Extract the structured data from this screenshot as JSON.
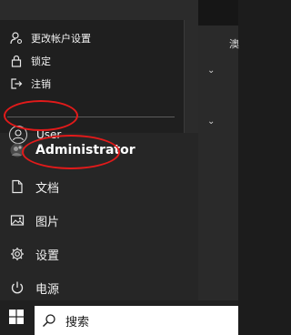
{
  "background_window": {
    "text": "澳",
    "chevron_1": "⌄",
    "chevron_2": "⌄"
  },
  "user_flyout": {
    "items": [
      {
        "label": "更改帐户设置",
        "icon": "account-settings-icon"
      },
      {
        "label": "锁定",
        "icon": "lock-icon"
      },
      {
        "label": "注销",
        "icon": "sign-out-icon"
      }
    ],
    "other_user": {
      "label": "User",
      "icon": "user-avatar-icon"
    }
  },
  "current_user": {
    "label": "Administrator",
    "icon": "user-photo-icon"
  },
  "rail": {
    "items": [
      {
        "label": "文档",
        "icon": "document-icon"
      },
      {
        "label": "图片",
        "icon": "pictures-icon"
      },
      {
        "label": "设置",
        "icon": "gear-icon"
      },
      {
        "label": "电源",
        "icon": "power-icon"
      }
    ]
  },
  "taskbar": {
    "search_placeholder": "搜索",
    "start_icon": "windows-logo-icon"
  },
  "colors": {
    "annotation": "#e21a1a",
    "menu_bg": "#2b2b2b",
    "flyout_bg": "#1f1f1f",
    "taskbar_bg": "#202020"
  }
}
